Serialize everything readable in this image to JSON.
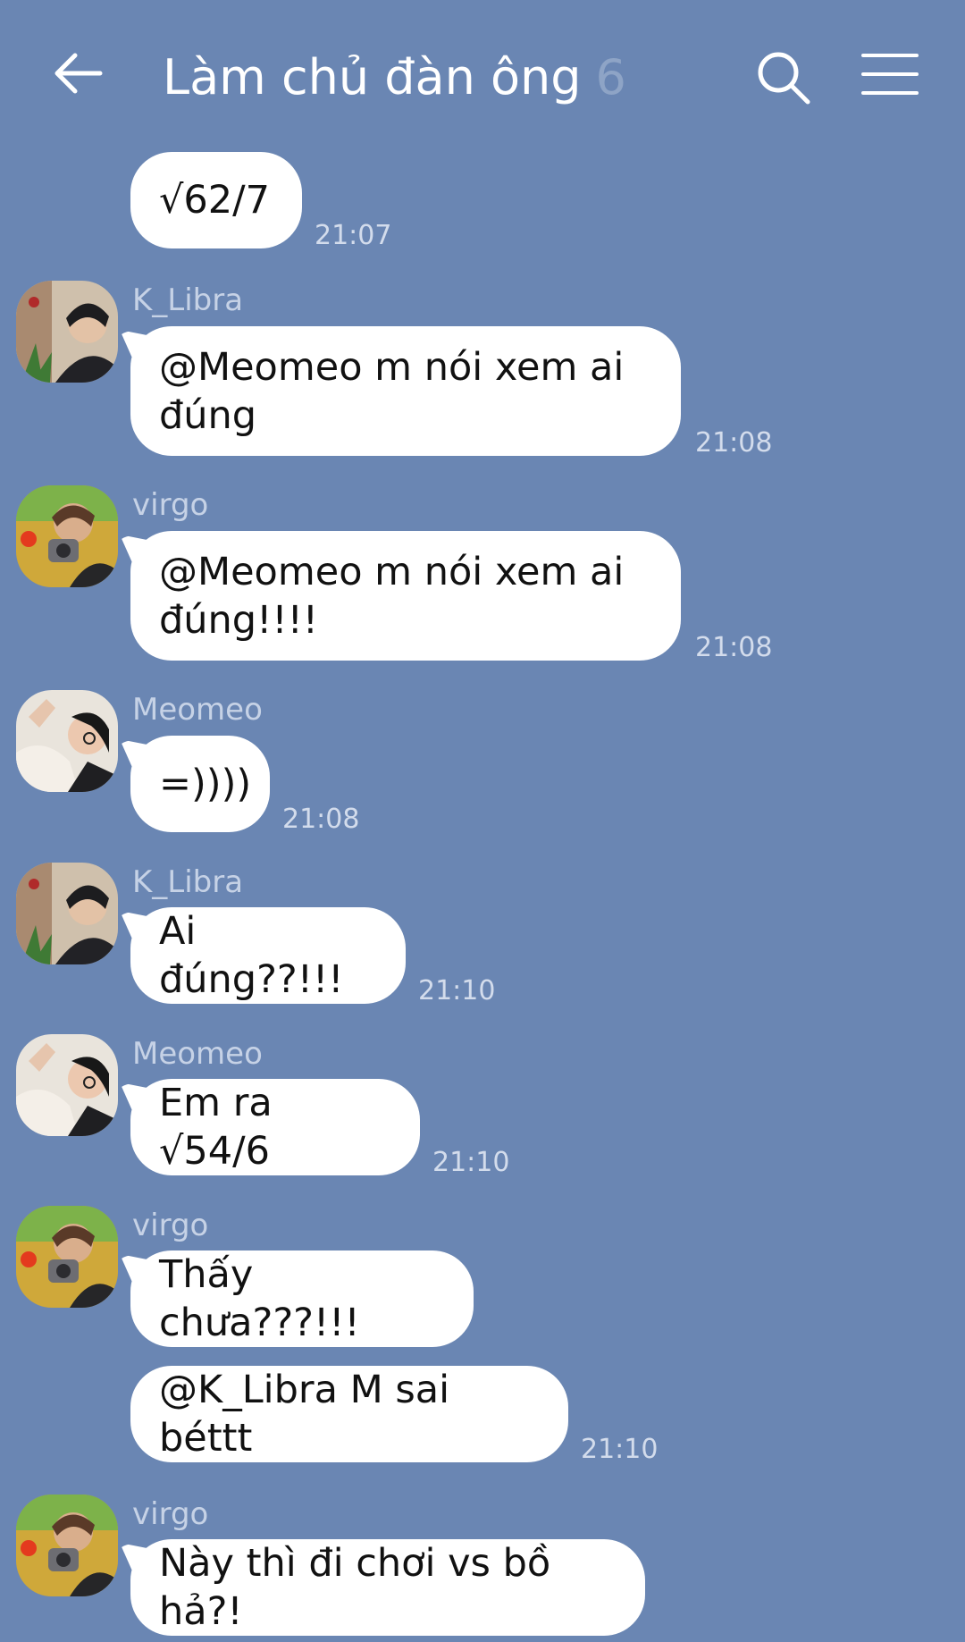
{
  "header": {
    "title": "Làm chủ đàn ông",
    "member_count": "6",
    "back_icon": "arrow-left-icon",
    "search_icon": "search-icon",
    "menu_icon": "menu-icon"
  },
  "messages": [
    {
      "sender": "",
      "text": "√62/7",
      "time": "21:07"
    },
    {
      "sender": "K_Libra",
      "text": "@Meomeo m nói xem ai\nđúng",
      "time": "21:08"
    },
    {
      "sender": "virgo",
      "text": "@Meomeo m nói xem ai\nđúng!!!!",
      "time": "21:08"
    },
    {
      "sender": "Meomeo",
      "text": "=))))",
      "time": "21:08"
    },
    {
      "sender": "K_Libra",
      "text": "Ai đúng??!!!",
      "time": "21:10"
    },
    {
      "sender": "Meomeo",
      "text": "Em ra √54/6",
      "time": "21:10"
    },
    {
      "sender": "virgo",
      "text": "Thấy chưa???!!!",
      "time": ""
    },
    {
      "sender": "",
      "text": "@K_Libra M sai béttt",
      "time": "21:10"
    },
    {
      "sender": "virgo",
      "text": "Này thì đi chơi vs bồ hả?!",
      "time": ""
    }
  ]
}
